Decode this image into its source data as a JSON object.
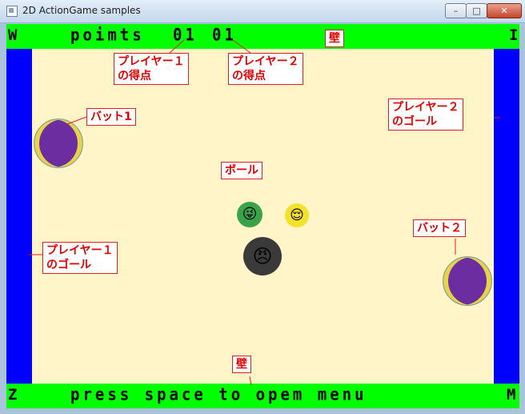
{
  "window": {
    "title": "2D ActionGame samples",
    "min": "–",
    "max": "□",
    "close": "✕"
  },
  "hud": {
    "key_w": "W",
    "key_i": "I",
    "key_z": "Z",
    "key_m": "M",
    "points_label": "poimts",
    "score_p1": "01",
    "score_p2": "01",
    "footer": "press space to opem menu"
  },
  "annotations": {
    "wall_top": "壁",
    "wall_bottom": "壁",
    "p1_score": "プレイヤー１\nの得点",
    "p2_score": "プレイヤー２\nの得点",
    "bat1": "バット1",
    "bat2": "バット２",
    "ball": "ボール",
    "p1_goal": "プレイヤー１\nのゴール",
    "p2_goal": "プレイヤー２\nのゴール"
  },
  "balls": {
    "green_face": "😜",
    "yellow_face": "😌",
    "black_face": "😠"
  },
  "colors": {
    "field": "#fff5c8",
    "wall": "#00ff00",
    "goal": "#0000ff",
    "bat": "#6c2da0",
    "annotation": "#e00000"
  }
}
